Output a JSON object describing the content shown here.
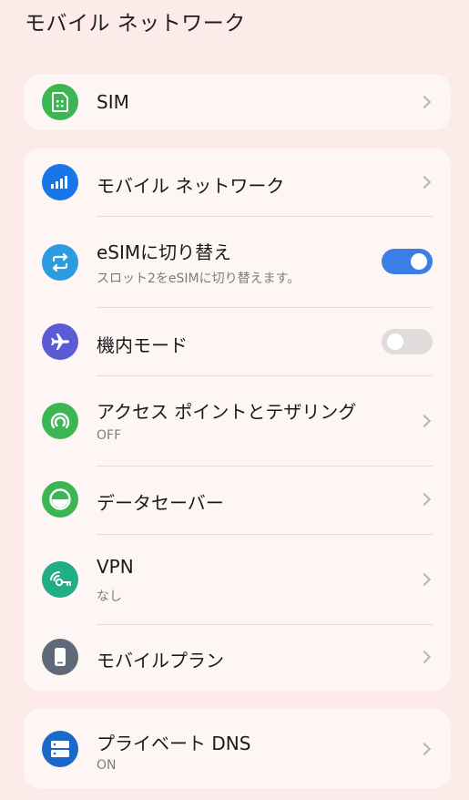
{
  "header": {
    "title": "モバイル ネットワーク"
  },
  "colors": {
    "background": "#fcebe8",
    "card": "#fdf6f4",
    "green": "#3cb653",
    "blue": "#1877e8",
    "sky": "#2d9be0",
    "purple": "#5b5bd6",
    "teal": "#1fae86",
    "slate": "#5f6978",
    "navy": "#1a68c8",
    "toggle_on": "#3b7ee6",
    "toggle_off": "#e0dcdb"
  },
  "sim_card": {
    "sim": {
      "label": "SIM",
      "icon": "sim-card-icon"
    }
  },
  "network_card": {
    "mobile_network": {
      "label": "モバイル ネットワーク",
      "icon": "signal-bars-icon"
    },
    "esim_switch": {
      "label": "eSIMに切り替え",
      "sub": "スロット2をeSIMに切り替えます。",
      "icon": "swap-arrows-icon",
      "enabled": true
    },
    "airplane": {
      "label": "機内モード",
      "icon": "airplane-icon",
      "enabled": false
    },
    "hotspot": {
      "label": "アクセス ポイントとテザリング",
      "sub": "OFF",
      "icon": "hotspot-icon"
    },
    "data_saver": {
      "label": "データセーバー",
      "icon": "data-saver-icon"
    },
    "vpn": {
      "label": "VPN",
      "sub": "なし",
      "icon": "vpn-key-icon"
    },
    "mobile_plan": {
      "label": "モバイルプラン",
      "icon": "phone-icon"
    }
  },
  "dns_card": {
    "private_dns": {
      "label": "プライベート DNS",
      "sub": "ON",
      "icon": "dns-server-icon"
    }
  }
}
